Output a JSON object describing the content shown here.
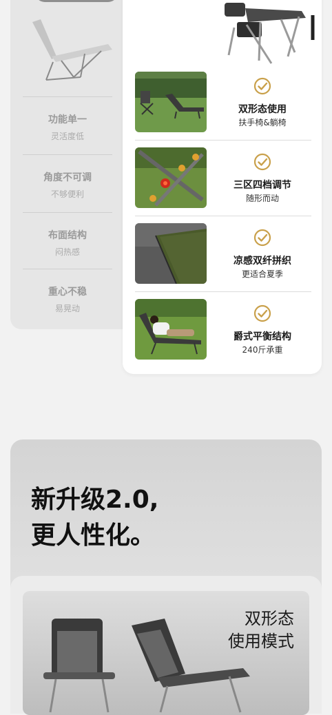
{
  "comparison": {
    "drawbacks": [
      {
        "title": "功能单一",
        "subtitle": "灵活度低"
      },
      {
        "title": "角度不可调",
        "subtitle": "不够便利"
      },
      {
        "title": "布面结构",
        "subtitle": "闷热感"
      },
      {
        "title": "重心不稳",
        "subtitle": "易晃动"
      }
    ]
  },
  "features": [
    {
      "title": "双形态使用",
      "subtitle": "扶手椅&躺椅",
      "icon": "check-circle-icon"
    },
    {
      "title": "三区四档调节",
      "subtitle": "随形而动",
      "icon": "check-circle-icon"
    },
    {
      "title": "凉感双纤拼织",
      "subtitle": "更适合夏季",
      "icon": "check-circle-icon"
    },
    {
      "title": "爵式平衡结构",
      "subtitle": "240斤承重",
      "icon": "check-circle-icon"
    }
  ],
  "upgrade": {
    "headline_line1": "新升级2.0,",
    "headline_line2": "更人性化。",
    "mode_line1": "双形态",
    "mode_line2": "使用模式"
  },
  "colors": {
    "accent_gold": "#c9a04a",
    "text_dark": "#1a1a1a",
    "muted_text": "#9a9a9a"
  }
}
